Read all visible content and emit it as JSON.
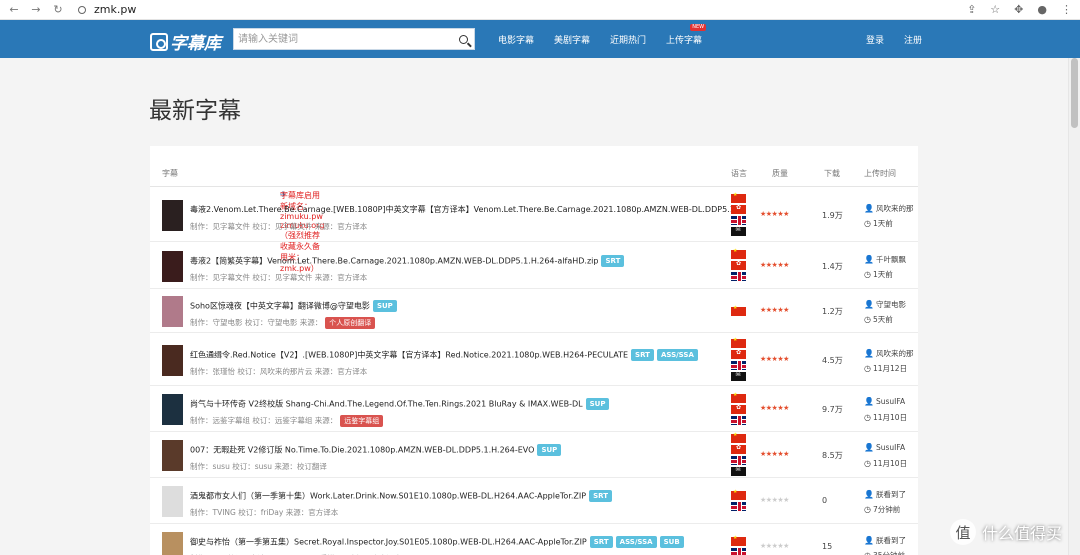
{
  "browser": {
    "url": "zmk.pw"
  },
  "header": {
    "logo": "字幕库",
    "search_placeholder": "请输入关键词",
    "nav": [
      "电影字幕",
      "美剧字幕",
      "近期热门",
      "上传字幕"
    ],
    "new_badge": "NEW",
    "login": "登录",
    "register": "注册"
  },
  "page_title": "最新字幕",
  "table": {
    "columns": {
      "subtitle": "字幕",
      "language": "语言",
      "quality": "质量",
      "downloads": "下载",
      "upload_time": "上传时间"
    },
    "notice": "字幕库启用新域名：zimuku.pw zimuku.org （强烈推荐收藏永久备用米：zmk.pw）",
    "rows": [
      {
        "title": "毒液2.Venom.Let.There.Be.Carnage.[WEB.1080P]中英文字幕【官方译本】Venom.Let.There.Be.Carnage.2021.1080p.AMZN.WEB-DL.DDP5.1.H",
        "tags": [],
        "meta": "制作：见字幕文件 校订：见字幕文件 来源：官方译本",
        "meta_tag": "",
        "langs": [
          "cn",
          "hk",
          "uk",
          "pirate"
        ],
        "stars": 5,
        "downloads": "1.9万",
        "uploader": "风吹来的那",
        "time": "1天前",
        "poster": "#2a2020"
      },
      {
        "title": "毒液2【简繁英字幕】Venom.Let.There.Be.Carnage.2021.1080p.AMZN.WEB-DL.DDP5.1.H.264-alfaHD.zip",
        "tags": [
          "SRT"
        ],
        "meta": "制作：见字幕文件 校订：见字幕文件 来源：官方译本",
        "meta_tag": "",
        "langs": [
          "cn",
          "hk",
          "uk"
        ],
        "stars": 5,
        "downloads": "1.4万",
        "uploader": "千叶飘飘",
        "time": "1天前",
        "poster": "#3a1c1c"
      },
      {
        "title": "Soho区惊魂夜【中英文字幕】翻译微博@守望电影",
        "tags": [
          "SUP"
        ],
        "meta": "制作：守望电影 校订：守望电影 来源：",
        "meta_tag": "个人原创翻译",
        "langs": [
          "cn"
        ],
        "stars": 5,
        "downloads": "1.2万",
        "uploader": "守望电影",
        "time": "5天前",
        "poster": "#b07a8a"
      },
      {
        "title": "红色通缉令.Red.Notice【V2】.[WEB.1080P]中英文字幕【官方译本】Red.Notice.2021.1080p.WEB.H264-PECULATE",
        "tags": [
          "SRT",
          "ASS/SSA"
        ],
        "meta": "制作：张瑾怡 校订：风吹来的那片云 来源：官方译本",
        "meta_tag": "",
        "langs": [
          "cn",
          "hk",
          "uk",
          "pirate"
        ],
        "stars": 5,
        "downloads": "4.5万",
        "uploader": "风吹来的那",
        "time": "11月12日",
        "poster": "#4a2a20"
      },
      {
        "title": "尚气与十环传奇 V2终校版 Shang-Chi.And.The.Legend.Of.The.Ten.Rings.2021 BluRay & IMAX.WEB-DL",
        "tags": [
          "SUP"
        ],
        "meta": "制作：远鉴字幕组 校订：远鉴字幕组 来源：",
        "meta_tag": "远鉴字幕组",
        "langs": [
          "cn",
          "hk",
          "uk"
        ],
        "stars": 5,
        "downloads": "9.7万",
        "uploader": "SusuIFA",
        "time": "11月10日",
        "poster": "#1c3040"
      },
      {
        "title": "007：无暇赴死 V2修订版 No.Time.To.Die.2021.1080p.AMZN.WEB-DL.DDP5.1.H.264-EVO",
        "tags": [
          "SUP"
        ],
        "meta": "制作：susu 校订：susu 来源：校订翻译",
        "meta_tag": "",
        "langs": [
          "cn",
          "hk",
          "uk",
          "pirate"
        ],
        "stars": 5,
        "downloads": "8.5万",
        "uploader": "SusuIFA",
        "time": "11月10日",
        "poster": "#5a3a2a"
      },
      {
        "title": "酒鬼都市女人们（第一季第十集）Work.Later.Drink.Now.S01E10.1080p.WEB-DL.H264.AAC-AppleTor.ZIP",
        "tags": [
          "SRT"
        ],
        "meta": "制作：TVING 校订：friDay 来源：官方译本",
        "meta_tag": "",
        "langs": [
          "cn",
          "uk"
        ],
        "stars": 0,
        "downloads": "0",
        "uploader": "朕看到了",
        "time": "7分钟前",
        "poster": "#ddd"
      },
      {
        "title": "御史与祚怡（第一季第五集）Secret.Royal.Inspector.Joy.S01E05.1080p.WEB-DL.H264.AAC-AppleTor.ZIP",
        "tags": [
          "SRT",
          "ASS/SSA",
          "SUB"
        ],
        "meta": "制作：tvN 校订：台湾friDay，iQIYI，香港Viu 来源：官方译本",
        "meta_tag": "",
        "langs": [
          "cn",
          "uk"
        ],
        "stars": 0,
        "downloads": "15",
        "uploader": "朕看到了",
        "time": "35分钟前",
        "poster": "#b89060"
      }
    ]
  },
  "watermark": "什么值得买",
  "watermark_badge": "值",
  "colors": {
    "header": "#2a78b7",
    "notice": "#e02020",
    "tag": "#5bc0de",
    "tag_red": "#d9534f",
    "star": "#e44f2f"
  }
}
